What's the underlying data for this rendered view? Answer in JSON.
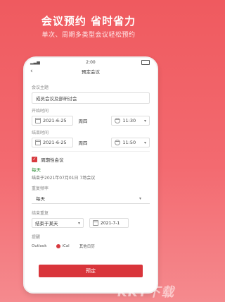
{
  "promo": {
    "headline": "会议预约 省时省力",
    "subline": "单次、周期多类型会议轻松预约"
  },
  "status": {
    "time": "2:00"
  },
  "nav": {
    "title": "预定会议",
    "back_icon": "chevron-left-icon"
  },
  "form": {
    "topic_label": "会议主题",
    "topic_value": "成员会议及部研讨会",
    "start_label": "开始时间",
    "start_date": "2021-6-25",
    "start_weekday": "周四",
    "start_time": "11:30",
    "end_label": "结束时间",
    "end_date": "2021-6-25",
    "end_weekday": "周四",
    "end_time": "11:50",
    "repeat_label": "周期性会议",
    "repeat_title": "每天",
    "repeat_desc": "结束于2021年07月01日 7场会议",
    "freq_label": "重复频率",
    "freq_value": "每天",
    "end_repeat_label": "结束重复",
    "end_repeat_value": "结束于某天",
    "end_repeat_date": "2021-7-1",
    "notify_label": "提醒",
    "notify_options": [
      "Outlook",
      "iCal",
      "其他日历"
    ],
    "submit_label": "预定"
  },
  "watermark": "KKT下载",
  "colors": {
    "accent": "#d9353b",
    "background": "#ef5a5f",
    "repeat_text": "#2a8d34"
  }
}
